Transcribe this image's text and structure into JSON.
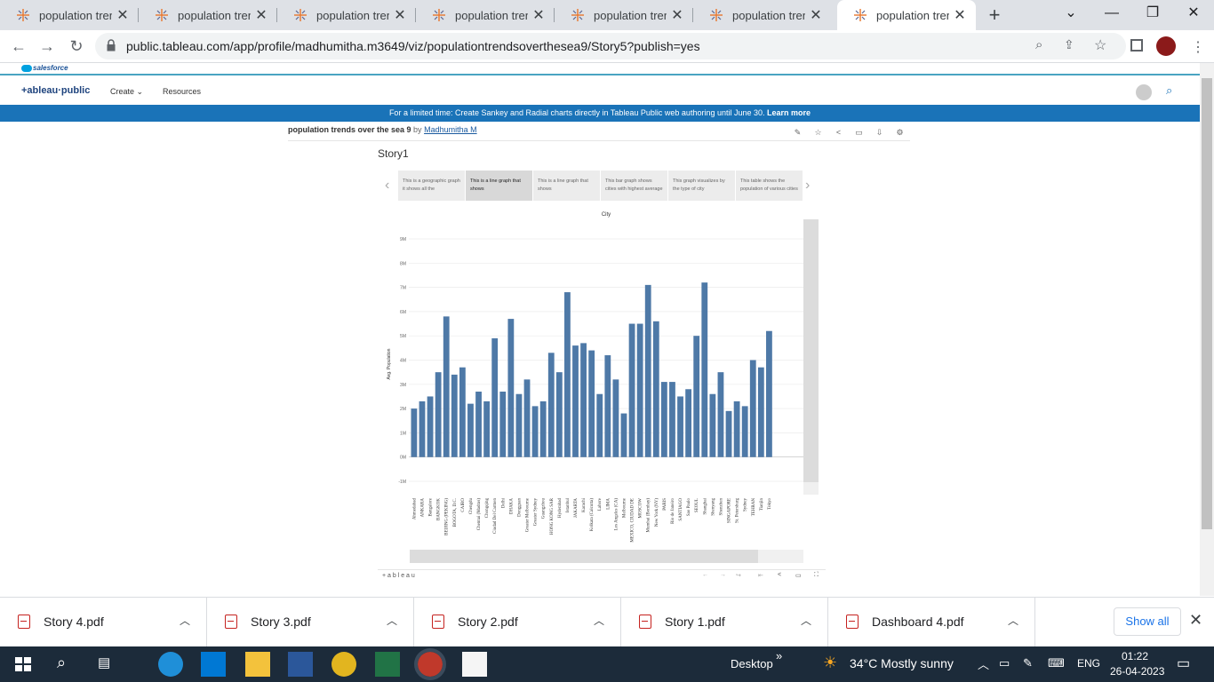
{
  "browser": {
    "tabs": [
      {
        "title": "population trends"
      },
      {
        "title": "population trends"
      },
      {
        "title": "population trends"
      },
      {
        "title": "population trends"
      },
      {
        "title": "population trends"
      },
      {
        "title": "population trends"
      },
      {
        "title": "population trends"
      }
    ],
    "new_tab": "+",
    "url": "public.tableau.com/app/profile/madhumitha.m3649/viz/populationtrendsoverthesea9/Story5?publish=yes"
  },
  "site": {
    "salesforce": "salesforce",
    "logo": "+ableau·public",
    "nav": [
      "Create",
      "Resources"
    ],
    "banner_text": "For a limited time: Create Sankey and Radial charts directly in Tableau Public web authoring until June 30.",
    "banner_link": "Learn more",
    "viz_title": "population trends over the sea 9",
    "by": "by",
    "author": "Madhumitha M"
  },
  "story": {
    "title": "Story1",
    "points": [
      "This is a geographic graph it shows all the",
      "This is a line graph that shows",
      "This is a line graph that shows",
      "This bar graph shows cities with highest average",
      "This graph visualizes by the type of city",
      "This table shows the population of various cities"
    ],
    "selected_point": 1,
    "footer_logo": "+ a b l e a u"
  },
  "chart_data": {
    "type": "bar",
    "title": "City",
    "ylabel": "Avg. Population",
    "yticks": [
      "9M",
      "8M",
      "7M",
      "6M",
      "5M",
      "4M",
      "3M",
      "2M",
      "1M",
      "0M",
      "-1M"
    ],
    "ylim": [
      -1,
      9
    ],
    "grid": true,
    "categories": [
      "Ahmedabad",
      "ANKARA",
      "Bangalore",
      "BANGKOK",
      "BEIJING (PEKING)",
      "BOGOTA, D.C.",
      "CAIRO",
      "Chengdu",
      "Chennai (Madras)",
      "Chongqing",
      "Ciudad Del Carmen",
      "Delhi",
      "DHAKA",
      "Dongguan",
      "Greater Melbourne",
      "Greater Sydney",
      "Guangzhou",
      "HONG KONG SAR",
      "Hyderabad",
      "Istanbul",
      "JAKARTA",
      "Karachi",
      "Kolkata (Calcutta)",
      "Lahore",
      "LIMA",
      "Los Angeles (CA)",
      "Melbourne",
      "MEXICO, CIUDAD DE",
      "MOSCOW",
      "Mumbai (Bombay)",
      "New York (NY)",
      "PARIS",
      "Rio de Janeiro",
      "SANTIAGO",
      "Sao Paulo",
      "SEOUL",
      "Shanghai",
      "Shenyang",
      "Shenzhen",
      "SINGAPORE",
      "St. Petersburg",
      "Sydney",
      "TEHRAN",
      "Tianjin",
      "Tokyo"
    ],
    "values": [
      2.0,
      2.3,
      2.5,
      3.5,
      5.8,
      3.4,
      3.7,
      2.2,
      2.7,
      2.3,
      4.9,
      2.7,
      5.7,
      2.6,
      3.2,
      2.1,
      2.3,
      4.3,
      3.5,
      6.8,
      4.6,
      4.7,
      4.4,
      2.6,
      4.2,
      3.2,
      1.8,
      5.5,
      5.5,
      7.1,
      5.6,
      3.1,
      3.1,
      2.5,
      2.8,
      5.0,
      7.2,
      2.6,
      3.5,
      1.9,
      2.3,
      2.1,
      4.0,
      3.7,
      5.2
    ],
    "color": "#4e79a7"
  },
  "downloads": {
    "items": [
      "Story 4.pdf",
      "Story 3.pdf",
      "Story 2.pdf",
      "Story 1.pdf",
      "Dashboard 4.pdf"
    ],
    "show_all": "Show all"
  },
  "taskbar": {
    "desktop": "Desktop",
    "weather": "34°C  Mostly sunny",
    "lang": "ENG",
    "time": "01:22",
    "date": "26-04-2023"
  },
  "colors": {
    "banner": "#1a73b8",
    "bar": "#4e79a7",
    "taskbar": "#1c2b3a"
  }
}
